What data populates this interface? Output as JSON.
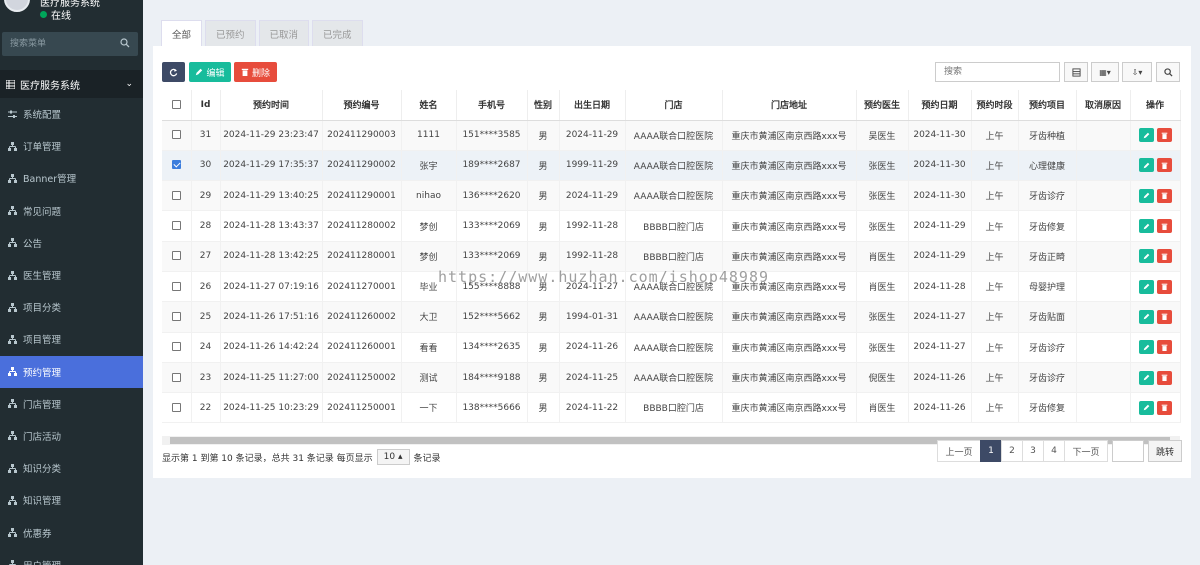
{
  "sidebar": {
    "user_name": "医疗服务系统",
    "status": "在线",
    "search_placeholder": "搜索菜单",
    "section": "医疗服务系统",
    "items": [
      {
        "label": "系统配置",
        "icon": "sliders-icon"
      },
      {
        "label": "订单管理",
        "icon": "sitemap-icon"
      },
      {
        "label": "Banner管理",
        "icon": "sitemap-icon"
      },
      {
        "label": "常见问题",
        "icon": "sitemap-icon"
      },
      {
        "label": "公告",
        "icon": "sitemap-icon"
      },
      {
        "label": "医生管理",
        "icon": "sitemap-icon"
      },
      {
        "label": "项目分类",
        "icon": "sitemap-icon"
      },
      {
        "label": "项目管理",
        "icon": "sitemap-icon"
      },
      {
        "label": "预约管理",
        "icon": "sitemap-icon",
        "active": true
      },
      {
        "label": "门店管理",
        "icon": "sitemap-icon"
      },
      {
        "label": "门店活动",
        "icon": "sitemap-icon"
      },
      {
        "label": "知识分类",
        "icon": "sitemap-icon"
      },
      {
        "label": "知识管理",
        "icon": "sitemap-icon"
      },
      {
        "label": "优惠券",
        "icon": "sitemap-icon"
      },
      {
        "label": "用户管理",
        "icon": "sitemap-icon"
      }
    ]
  },
  "tabs": [
    "全部",
    "已预约",
    "已取消",
    "已完成"
  ],
  "toolbar": {
    "edit_label": "编辑",
    "delete_label": "删除",
    "search_placeholder": "搜索"
  },
  "table": {
    "columns": [
      "Id",
      "预约时间",
      "预约编号",
      "姓名",
      "手机号",
      "性别",
      "出生日期",
      "门店",
      "门店地址",
      "预约医生",
      "预约日期",
      "预约时段",
      "预约项目",
      "取消原因",
      "操作"
    ],
    "rows": [
      [
        "31",
        "2024-11-29 23:23:47",
        "202411290003",
        "1111",
        "151****3585",
        "男",
        "2024-11-29",
        "AAAA联合口腔医院",
        "重庆市黄浦区南京西路xxx号",
        "吴医生",
        "2024-11-30",
        "上午",
        "牙齿种植",
        ""
      ],
      [
        "30",
        "2024-11-29 17:35:37",
        "202411290002",
        "张宇",
        "189****2687",
        "男",
        "1999-11-29",
        "AAAA联合口腔医院",
        "重庆市黄浦区南京西路xxx号",
        "张医生",
        "2024-11-30",
        "上午",
        "心理健康",
        ""
      ],
      [
        "29",
        "2024-11-29 13:40:25",
        "202411290001",
        "nihao",
        "136****2620",
        "男",
        "2024-11-29",
        "AAAA联合口腔医院",
        "重庆市黄浦区南京西路xxx号",
        "张医生",
        "2024-11-30",
        "上午",
        "牙齿诊疗",
        ""
      ],
      [
        "28",
        "2024-11-28 13:43:37",
        "202411280002",
        "梦创",
        "133****2069",
        "男",
        "1992-11-28",
        "BBBB口腔门店",
        "重庆市黄浦区南京西路xxx号",
        "张医生",
        "2024-11-29",
        "上午",
        "牙齿修复",
        ""
      ],
      [
        "27",
        "2024-11-28 13:42:25",
        "202411280001",
        "梦创",
        "133****2069",
        "男",
        "1992-11-28",
        "BBBB口腔门店",
        "重庆市黄浦区南京西路xxx号",
        "肖医生",
        "2024-11-29",
        "上午",
        "牙齿正畸",
        ""
      ],
      [
        "26",
        "2024-11-27 07:19:16",
        "202411270001",
        "毕业",
        "155****8888",
        "男",
        "2024-11-27",
        "AAAA联合口腔医院",
        "重庆市黄浦区南京西路xxx号",
        "肖医生",
        "2024-11-28",
        "上午",
        "母婴护理",
        ""
      ],
      [
        "25",
        "2024-11-26 17:51:16",
        "202411260002",
        "大卫",
        "152****5662",
        "男",
        "1994-01-31",
        "AAAA联合口腔医院",
        "重庆市黄浦区南京西路xxx号",
        "张医生",
        "2024-11-27",
        "上午",
        "牙齿贴面",
        ""
      ],
      [
        "24",
        "2024-11-26 14:42:24",
        "202411260001",
        "看看",
        "134****2635",
        "男",
        "2024-11-26",
        "AAAA联合口腔医院",
        "重庆市黄浦区南京西路xxx号",
        "张医生",
        "2024-11-27",
        "上午",
        "牙齿诊疗",
        ""
      ],
      [
        "23",
        "2024-11-25 11:27:00",
        "202411250002",
        "测试",
        "184****9188",
        "男",
        "2024-11-25",
        "AAAA联合口腔医院",
        "重庆市黄浦区南京西路xxx号",
        "倪医生",
        "2024-11-26",
        "上午",
        "牙齿诊疗",
        ""
      ],
      [
        "22",
        "2024-11-25 10:23:29",
        "202411250001",
        "一下",
        "138****5666",
        "男",
        "2024-11-22",
        "BBBB口腔门店",
        "重庆市黄浦区南京西路xxx号",
        "肖医生",
        "2024-11-26",
        "上午",
        "牙齿修复",
        ""
      ]
    ],
    "checked_row": 1
  },
  "footer": {
    "info_prefix": "显示第 1 到第 10 条记录，总共 31 条记录 每页显示",
    "page_size": "10",
    "info_suffix": "条记录",
    "prev": "上一页",
    "pages": [
      "1",
      "2",
      "3",
      "4"
    ],
    "current_page": "1",
    "next": "下一页",
    "jump": "跳转"
  },
  "watermark": "https://www.huzhan.com/ishop48989",
  "colors": {
    "sidebar_bg": "#222d32",
    "active_item": "#4a6fdc",
    "edit_green": "#18bc9c",
    "delete_red": "#e74c3c",
    "pager_active": "#3d4a66"
  }
}
